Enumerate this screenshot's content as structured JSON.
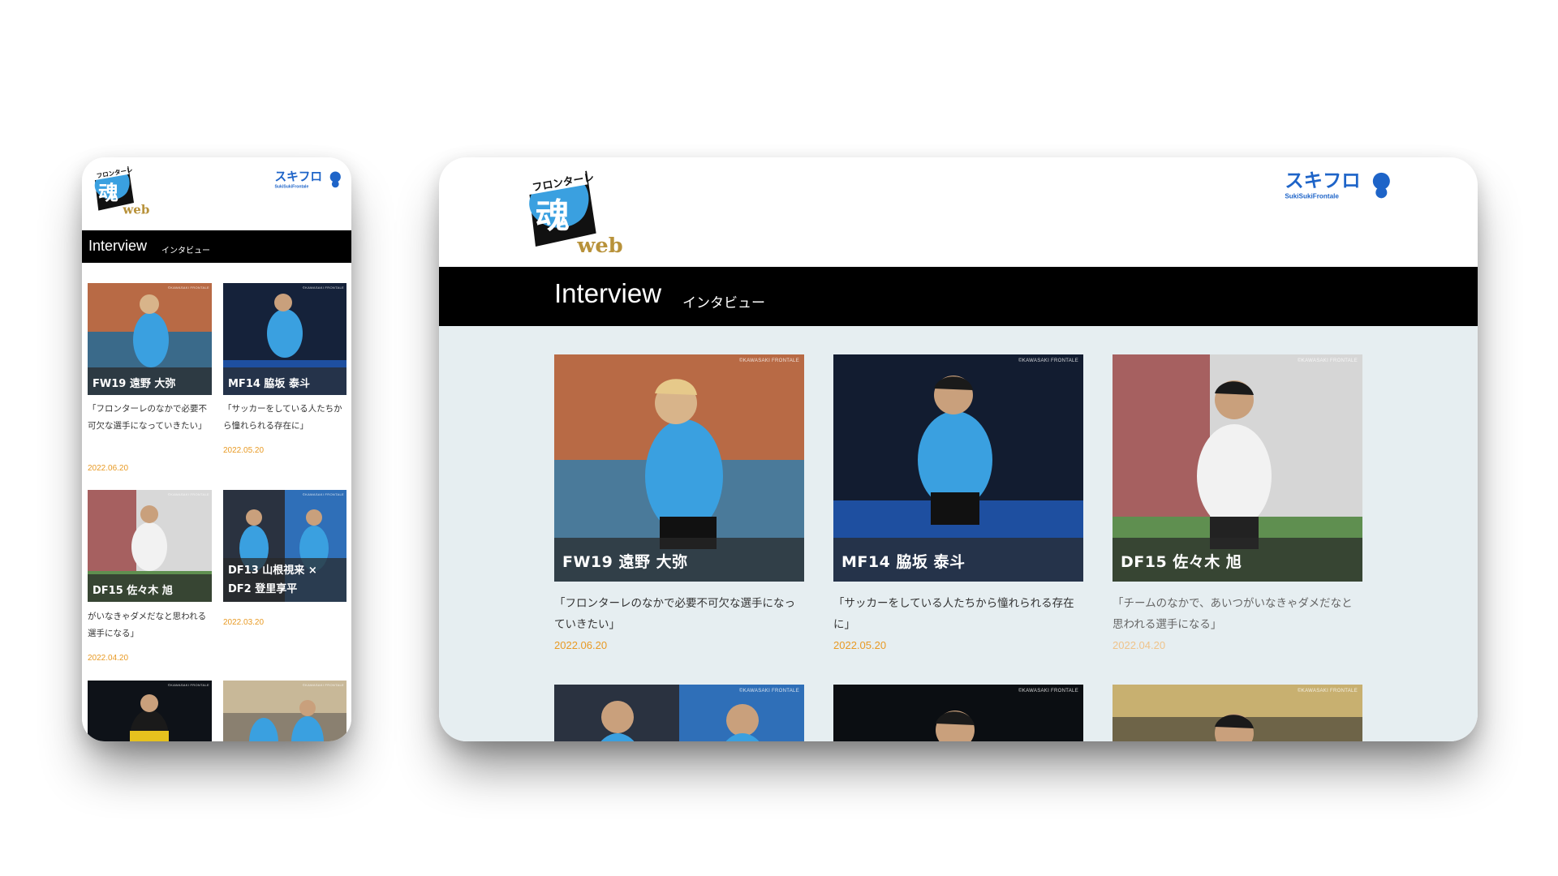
{
  "brand": {
    "logo_main": {
      "top": "フロンターレ",
      "kanji": "魂",
      "sub": "web"
    },
    "logo_suki": {
      "main": "スキフロ",
      "sub": "SukiSukiFrontale"
    }
  },
  "section": {
    "title_en": "Interview",
    "title_ja": "インタビュー"
  },
  "credit": "©KAWASAKI FRONTALE",
  "colors": {
    "accent": "#e89a24",
    "bar": "#000000",
    "content_bg": "#e6eef1",
    "brand_blue": "#1e64c8"
  },
  "articles": [
    {
      "name": "FW19 遠野 大弥",
      "quote": "「フロンターレのなかで必要不可欠な選手になっていきたい」",
      "date": "2022.06.20"
    },
    {
      "name": "MF14 脇坂 泰斗",
      "quote": "「サッカーをしている人たちから憧れられる存在に」",
      "date": "2022.05.20"
    },
    {
      "name": "DF15 佐々木 旭",
      "quote": "「チームのなかで、あいつがいなきゃダメだなと思われる選手になる」",
      "date": "2022.04.20"
    },
    {
      "name_line1": "DF13 山根視来 ×",
      "name_line2": "DF2 登里享平",
      "date": "2022.03.20"
    }
  ],
  "phone_view": {
    "a1_quote": "「フロンターレのなかで必要不可欠な選手になっていきたい」",
    "a2_quote": "「サッカーをしている人たちから憧れられる存在に」",
    "a3_quote": "がいなきゃダメだなと思われる選手になる」"
  },
  "tablet_view": {
    "a1_quote": "「フロンターレのなかで必要不可欠な選手になっていきたい」",
    "a2_quote": "「サッカーをしている人たちから憧れられる存在に」",
    "a3_quote": "「チームのなかで、あいつがいなきゃダメだなと思われる選手になる」"
  }
}
